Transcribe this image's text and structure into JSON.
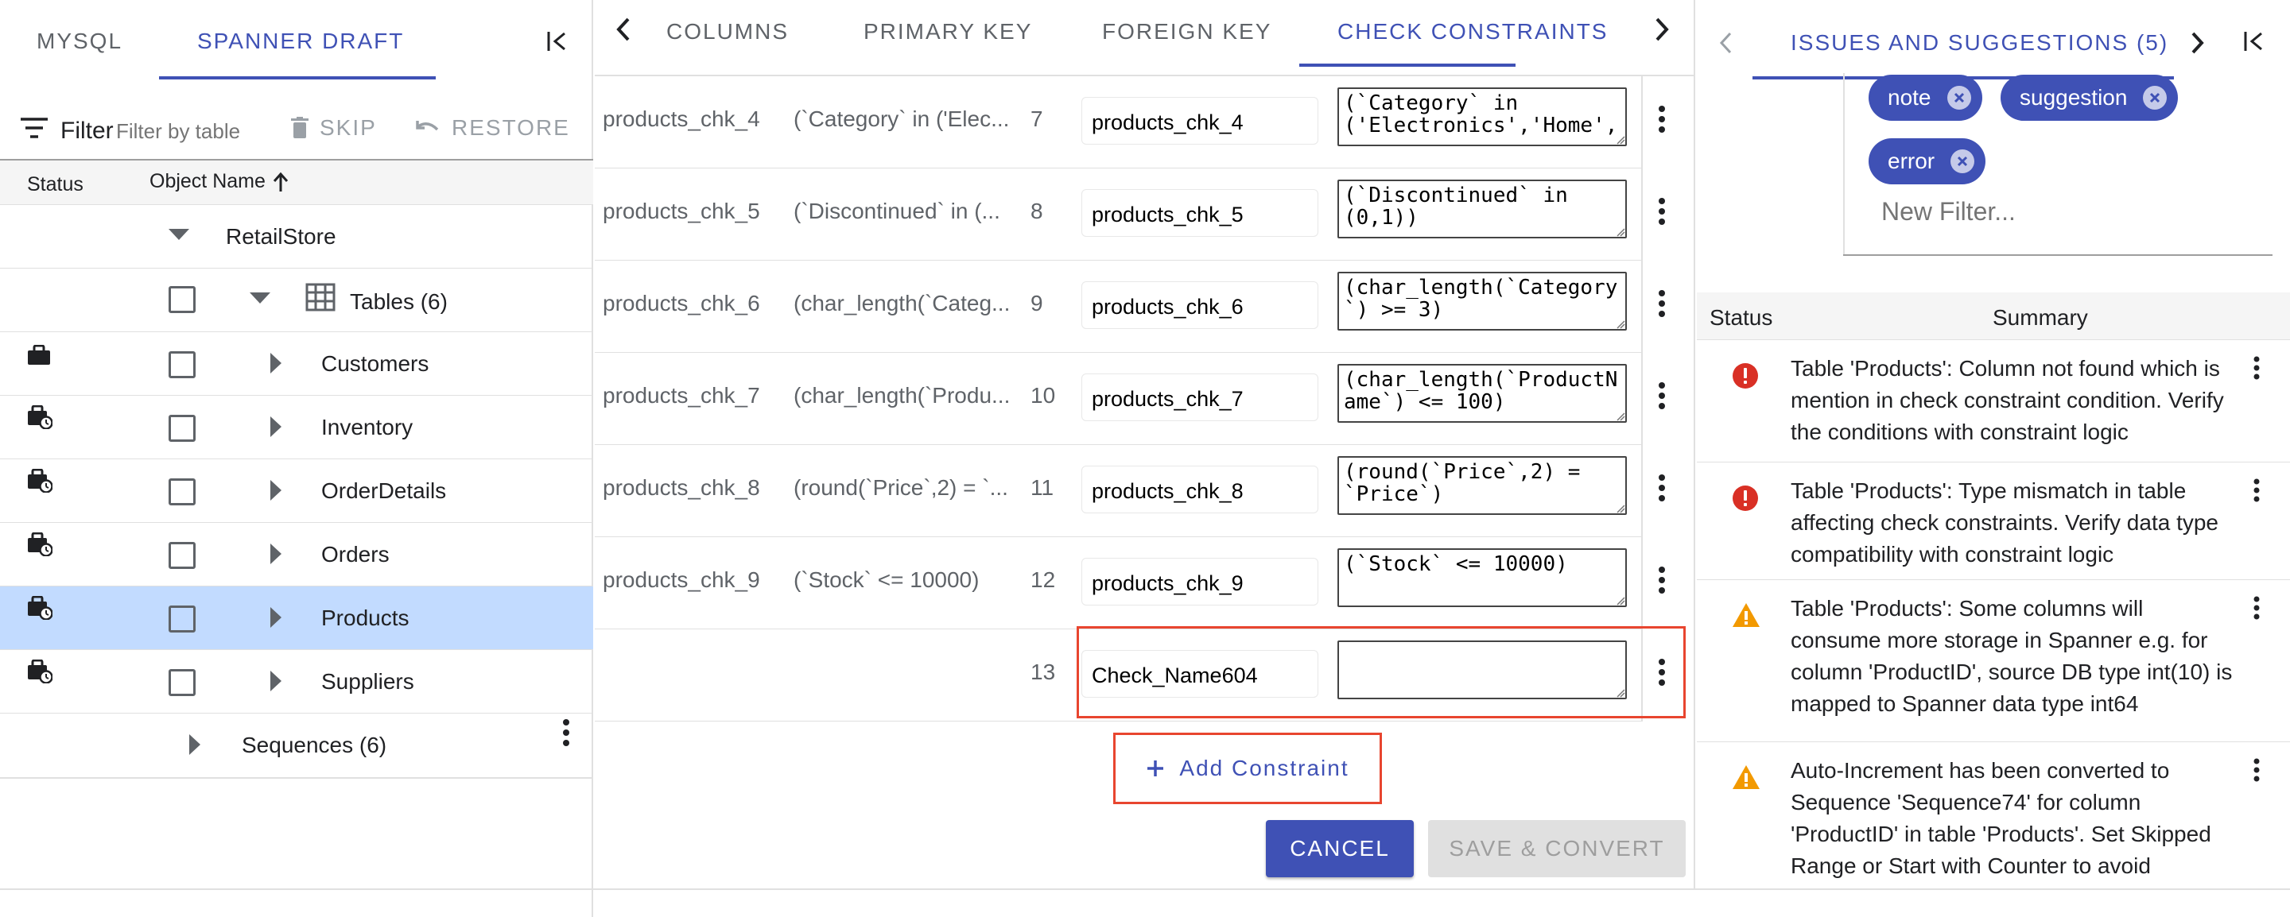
{
  "left": {
    "tabs": [
      "MYSQL",
      "SPANNER DRAFT"
    ],
    "active_tab": "SPANNER DRAFT",
    "filter_label": "Filter",
    "filter_placeholder": "Filter by table",
    "skip_label": "SKIP",
    "restore_label": "RESTORE",
    "header_status": "Status",
    "header_object_name": "Object Name",
    "tree": {
      "root": "RetailStore",
      "tables_label": "Tables (6)",
      "tables": [
        "Customers",
        "Inventory",
        "OrderDetails",
        "Orders",
        "Products",
        "Suppliers"
      ],
      "selected_table": "Products",
      "sequences_label": "Sequences (6)"
    }
  },
  "middle": {
    "tabs": [
      "COLUMNS",
      "PRIMARY KEY",
      "FOREIGN KEY",
      "CHECK CONSTRAINTS"
    ],
    "active_tab": "CHECK CONSTRAINTS",
    "rows": [
      {
        "name": "products_chk_4",
        "expr": "(`Category` in ('Elec...",
        "num": "7",
        "input": "products_chk_4",
        "condition": "(`Category` in\n('Electronics','Home',"
      },
      {
        "name": "products_chk_5",
        "expr": "(`Discontinued` in (...",
        "num": "8",
        "input": "products_chk_5",
        "condition": "(`Discontinued` in\n(0,1))"
      },
      {
        "name": "products_chk_6",
        "expr": "(char_length(`Categ...",
        "num": "9",
        "input": "products_chk_6",
        "condition": "(char_length(`Category\n`) >= 3)"
      },
      {
        "name": "products_chk_7",
        "expr": "(char_length(`Produ...",
        "num": "10",
        "input": "products_chk_7",
        "condition": "(char_length(`ProductN\name`) <= 100)"
      },
      {
        "name": "products_chk_8",
        "expr": "(round(`Price`,2) = `...",
        "num": "11",
        "input": "products_chk_8",
        "condition": "(round(`Price`,2) =\n`Price`)"
      },
      {
        "name": "products_chk_9",
        "expr": "(`Stock` <= 10000)",
        "num": "12",
        "input": "products_chk_9",
        "condition": "(`Stock` <= 10000)"
      },
      {
        "name": "",
        "expr": "",
        "num": "13",
        "input": "Check_Name604",
        "condition": ""
      }
    ],
    "add_constraint_label": "Add Constraint",
    "cancel_label": "CANCEL",
    "save_label": "SAVE & CONVERT"
  },
  "right": {
    "tab_label": "ISSUES AND SUGGESTIONS (5)",
    "chips": [
      "note",
      "suggestion",
      "error"
    ],
    "new_filter_placeholder": "New Filter...",
    "header_status": "Status",
    "header_summary": "Summary",
    "issues": [
      {
        "severity": "error",
        "text": "Table 'Products': Column not found which is mention in check constraint condition. Verify the conditions with constraint logic"
      },
      {
        "severity": "error",
        "text": "Table 'Products': Type mismatch in table affecting check constraints. Verify data type compatibility with constraint logic"
      },
      {
        "severity": "warning",
        "text": "Table 'Products': Some columns will consume more storage in Spanner e.g. for column 'ProductID', source DB type int(10) is mapped to Spanner data type int64"
      },
      {
        "severity": "warning",
        "text": "Auto-Increment has been converted to Sequence 'Sequence74' for column 'ProductID' in table 'Products'. Set Skipped Range or Start with Counter to avoid"
      }
    ]
  },
  "colors": {
    "primary": "#3f51b5",
    "error": "#d93025",
    "warning": "#f29900",
    "highlight": "#e8452f",
    "selected_row": "#c2dbff"
  }
}
